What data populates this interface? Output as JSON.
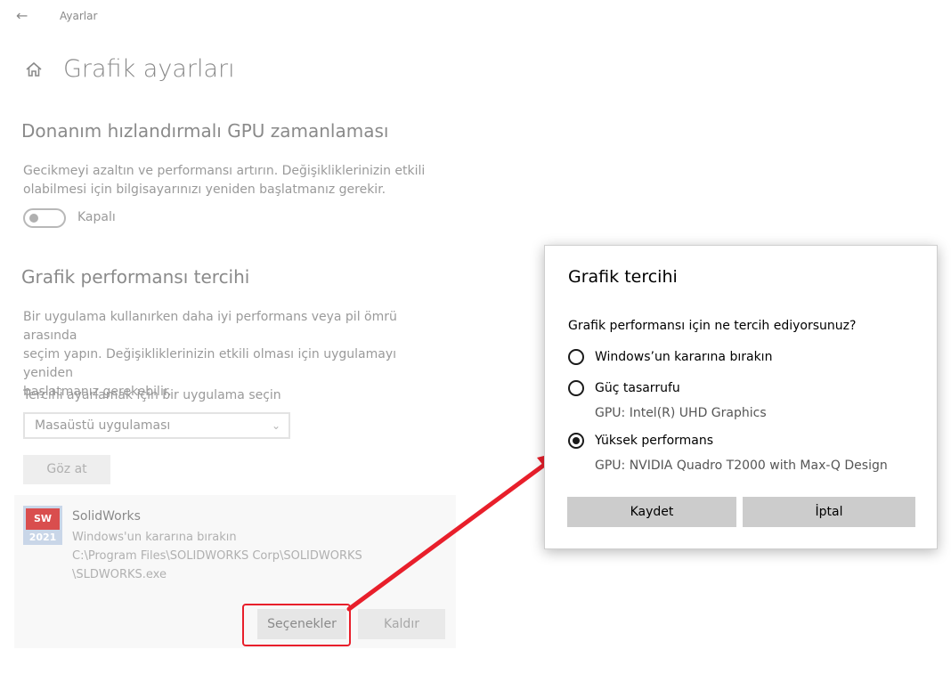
{
  "nav": {
    "back_icon": "arrow-left-icon",
    "title": "Ayarlar"
  },
  "page": {
    "home_icon": "home-icon",
    "title": "Grafik ayarları"
  },
  "gpu_scheduling": {
    "title": "Donanım hızlandırmalı GPU zamanlaması",
    "desc_line1": "Gecikmeyi azaltın ve performansı artırın. Değişikliklerinizin etkili",
    "desc_line2": "olabilmesi için bilgisayarınızı yeniden başlatmanız gerekir.",
    "toggle_label": "Kapalı"
  },
  "graphics_pref": {
    "title": "Grafik performansı tercihi",
    "desc_line1": "Bir uygulama kullanırken daha iyi performans veya pil ömrü arasında",
    "desc_line2": "seçim yapın. Değişikliklerinizin etkili olması için uygulamayı yeniden",
    "desc_line3": "başlatmanız gerekebilir.",
    "select_label": "Tercihi ayarlamak için bir uygulama seçin",
    "select_value": "Masaüstü uygulaması",
    "browse_button": "Göz at"
  },
  "app": {
    "icon_top": "SW",
    "icon_year": "2021",
    "name": "SolidWorks",
    "preference": "Windows'un kararına bırakın",
    "path_line1": "C:\\Program Files\\SOLIDWORKS Corp\\SOLIDWORKS",
    "path_line2": "\\SLDWORKS.exe",
    "options_button": "Seçenekler",
    "remove_button": "Kaldır"
  },
  "dialog": {
    "title": "Grafik tercihi",
    "question": "Grafik performansı için ne tercih ediyorsunuz?",
    "options": [
      {
        "label": "Windows’un kararına bırakın",
        "selected": false
      },
      {
        "label": "Güç tasarrufu",
        "sub": "GPU: Intel(R) UHD Graphics",
        "selected": false
      },
      {
        "label": "Yüksek performans",
        "sub": "GPU: NVIDIA Quadro T2000 with Max-Q Design",
        "selected": true
      }
    ],
    "save_button": "Kaydet",
    "cancel_button": "İptal"
  },
  "colors": {
    "annotation_red": "#e81f2b",
    "dialog_button_bg": "#cccccc"
  }
}
